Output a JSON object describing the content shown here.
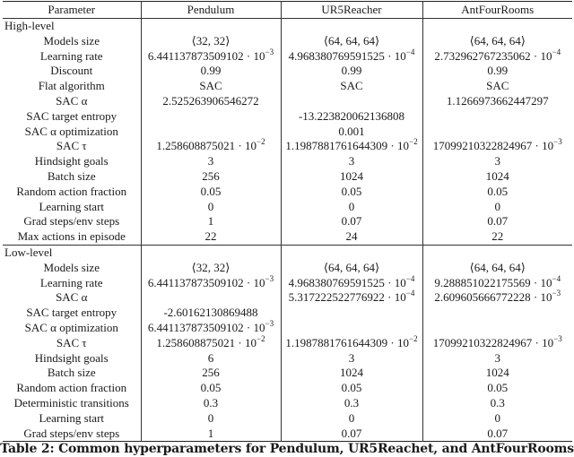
{
  "table": {
    "headers": [
      "Parameter",
      "Pendulum",
      "UR5Reacher",
      "AntFourRooms"
    ],
    "sections": [
      {
        "label": "High-level",
        "rows": [
          {
            "param": "Models size",
            "values": [
              "⟨32, 32⟩",
              "⟨64, 64, 64⟩",
              "⟨64, 64, 64⟩"
            ]
          },
          {
            "param": "Learning rate",
            "values": [
              {
                "mantissa": "6.441137873509102 · 10",
                "exp": "−3"
              },
              {
                "mantissa": "4.968380769591525 · 10",
                "exp": "−4"
              },
              {
                "mantissa": "2.732962767235062 · 10",
                "exp": "−4"
              }
            ]
          },
          {
            "param": "Discount",
            "values": [
              "0.99",
              "0.99",
              "0.99"
            ]
          },
          {
            "param": "Flat algorithm",
            "values": [
              "SAC",
              "SAC",
              "SAC"
            ]
          },
          {
            "param": "SAC α",
            "values": [
              "2.525263906546272",
              "",
              "1.1266973662447297"
            ]
          },
          {
            "param": "SAC target entropy",
            "values": [
              "",
              "-13.223820062136808",
              ""
            ]
          },
          {
            "param": "SAC α optimization",
            "values": [
              "",
              "0.001",
              ""
            ]
          },
          {
            "param": "SAC τ",
            "values": [
              {
                "mantissa": "1.258608875021 · 10",
                "exp": "−2"
              },
              {
                "mantissa": "1.1987881761644309 · 10",
                "exp": "−2"
              },
              {
                "mantissa": "17099210322824967 · 10",
                "exp": "−3"
              }
            ]
          },
          {
            "param": "Hindsight goals",
            "values": [
              "3",
              "3",
              "3"
            ]
          },
          {
            "param": "Batch size",
            "values": [
              "256",
              "1024",
              "1024"
            ]
          },
          {
            "param": "Random action fraction",
            "values": [
              "0.05",
              "0.05",
              "0.05"
            ]
          },
          {
            "param": "Learning start",
            "values": [
              "0",
              "0",
              "0"
            ]
          },
          {
            "param": "Grad steps/env steps",
            "values": [
              "1",
              "0.07",
              "0.07"
            ]
          },
          {
            "param": "Max actions in episode",
            "values": [
              "22",
              "24",
              "22"
            ]
          }
        ]
      },
      {
        "label": "Low-level",
        "rows": [
          {
            "param": "Models size",
            "values": [
              "⟨32, 32⟩",
              "⟨64, 64, 64⟩",
              "⟨64, 64, 64⟩"
            ]
          },
          {
            "param": "Learning rate",
            "values": [
              {
                "mantissa": "6.441137873509102 · 10",
                "exp": "−3"
              },
              {
                "mantissa": "4.968380769591525 · 10",
                "exp": "−4"
              },
              {
                "mantissa": "9.288851022175569 · 10",
                "exp": "−4"
              }
            ]
          },
          {
            "param": "SAC α",
            "values": [
              "",
              {
                "mantissa": "5.317222522776922 · 10",
                "exp": "−4"
              },
              {
                "mantissa": "2.609605666772228 · 10",
                "exp": "−3"
              }
            ]
          },
          {
            "param": "SAC target entropy",
            "values": [
              "-2.60162130869488",
              "",
              ""
            ]
          },
          {
            "param": "SAC α optimization",
            "values": [
              {
                "mantissa": "6.441137873509102 · 10",
                "exp": "−3"
              },
              "",
              ""
            ]
          },
          {
            "param": "SAC τ",
            "values": [
              {
                "mantissa": "1.258608875021 · 10",
                "exp": "−2"
              },
              {
                "mantissa": "1.1987881761644309 · 10",
                "exp": "−2"
              },
              {
                "mantissa": "17099210322824967 · 10",
                "exp": "−3"
              }
            ]
          },
          {
            "param": "Hindsight goals",
            "values": [
              "6",
              "3",
              "3"
            ]
          },
          {
            "param": "Batch size",
            "values": [
              "256",
              "1024",
              "1024"
            ]
          },
          {
            "param": "Random action fraction",
            "values": [
              "0.05",
              "0.05",
              "0.05"
            ]
          },
          {
            "param": "Deterministic transitions",
            "values": [
              "0.3",
              "0.3",
              "0.3"
            ]
          },
          {
            "param": "Learning start",
            "values": [
              "0",
              "0",
              "0"
            ]
          },
          {
            "param": "Grad steps/env steps",
            "values": [
              "1",
              "0.07",
              "0.07"
            ]
          }
        ]
      }
    ]
  },
  "caption": "Table 2: Common hyperparameters for Pendulum, UR5Reachet, and AntFourRooms"
}
